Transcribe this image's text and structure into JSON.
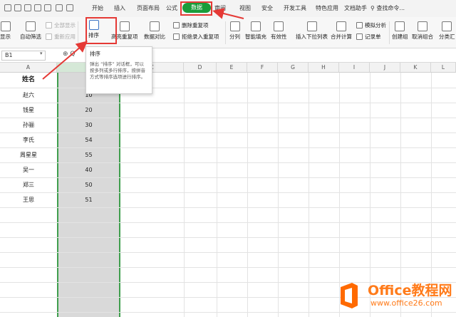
{
  "menu": {
    "items": [
      "开始",
      "插入",
      "页面布局",
      "公式",
      "数据",
      "审阅",
      "视图",
      "安全",
      "开发工具",
      "特色应用",
      "文档助手"
    ],
    "active": "数据",
    "search": "查找命令..."
  },
  "ribbon": {
    "show_all": "显示",
    "auto_filter": "自动筛选",
    "show_all_filter": "全部显示",
    "reapply": "重新应用",
    "sort": "排序",
    "highlight_dup": "高亮重复项",
    "compare": "数据对比",
    "delete_dup": "删除重复项",
    "reject_dup": "拒绝录入重复项",
    "split": "分列",
    "smart_fill": "智能填充",
    "validity": "有效性",
    "dropdown": "插入下拉列表",
    "merge_calc": "合并计算",
    "sim_analysis": "模拟分析",
    "record": "记录单",
    "create_group": "创建组",
    "ungroup": "取消组合",
    "subtotal": "分类汇"
  },
  "formula_bar": {
    "name_box": "B1",
    "fx": "⊕ Q"
  },
  "grid": {
    "columns": [
      "A",
      "B",
      "C",
      "D",
      "E",
      "F",
      "G",
      "H",
      "I",
      "J",
      "K",
      "L"
    ],
    "header_a": "姓名",
    "header_b": "价",
    "names": [
      "赵六",
      "钱星",
      "孙骊",
      "李氏",
      "周星星",
      "吴一",
      "郑三",
      "王思"
    ],
    "prices": [
      "10",
      "20",
      "30",
      "54",
      "55",
      "40",
      "50",
      "51"
    ]
  },
  "tooltip": {
    "title": "排序",
    "body": "弹出 “排序” 对话框，可以按多列或多行排序，按拼音方式等排序选项进行排序。"
  },
  "watermark": {
    "brand": "Office教程网",
    "url": "www.office26.com"
  },
  "colors": {
    "accent_green": "#1a9c3a",
    "highlight_red": "#e53935",
    "brand_orange": "#ff7b1a"
  }
}
